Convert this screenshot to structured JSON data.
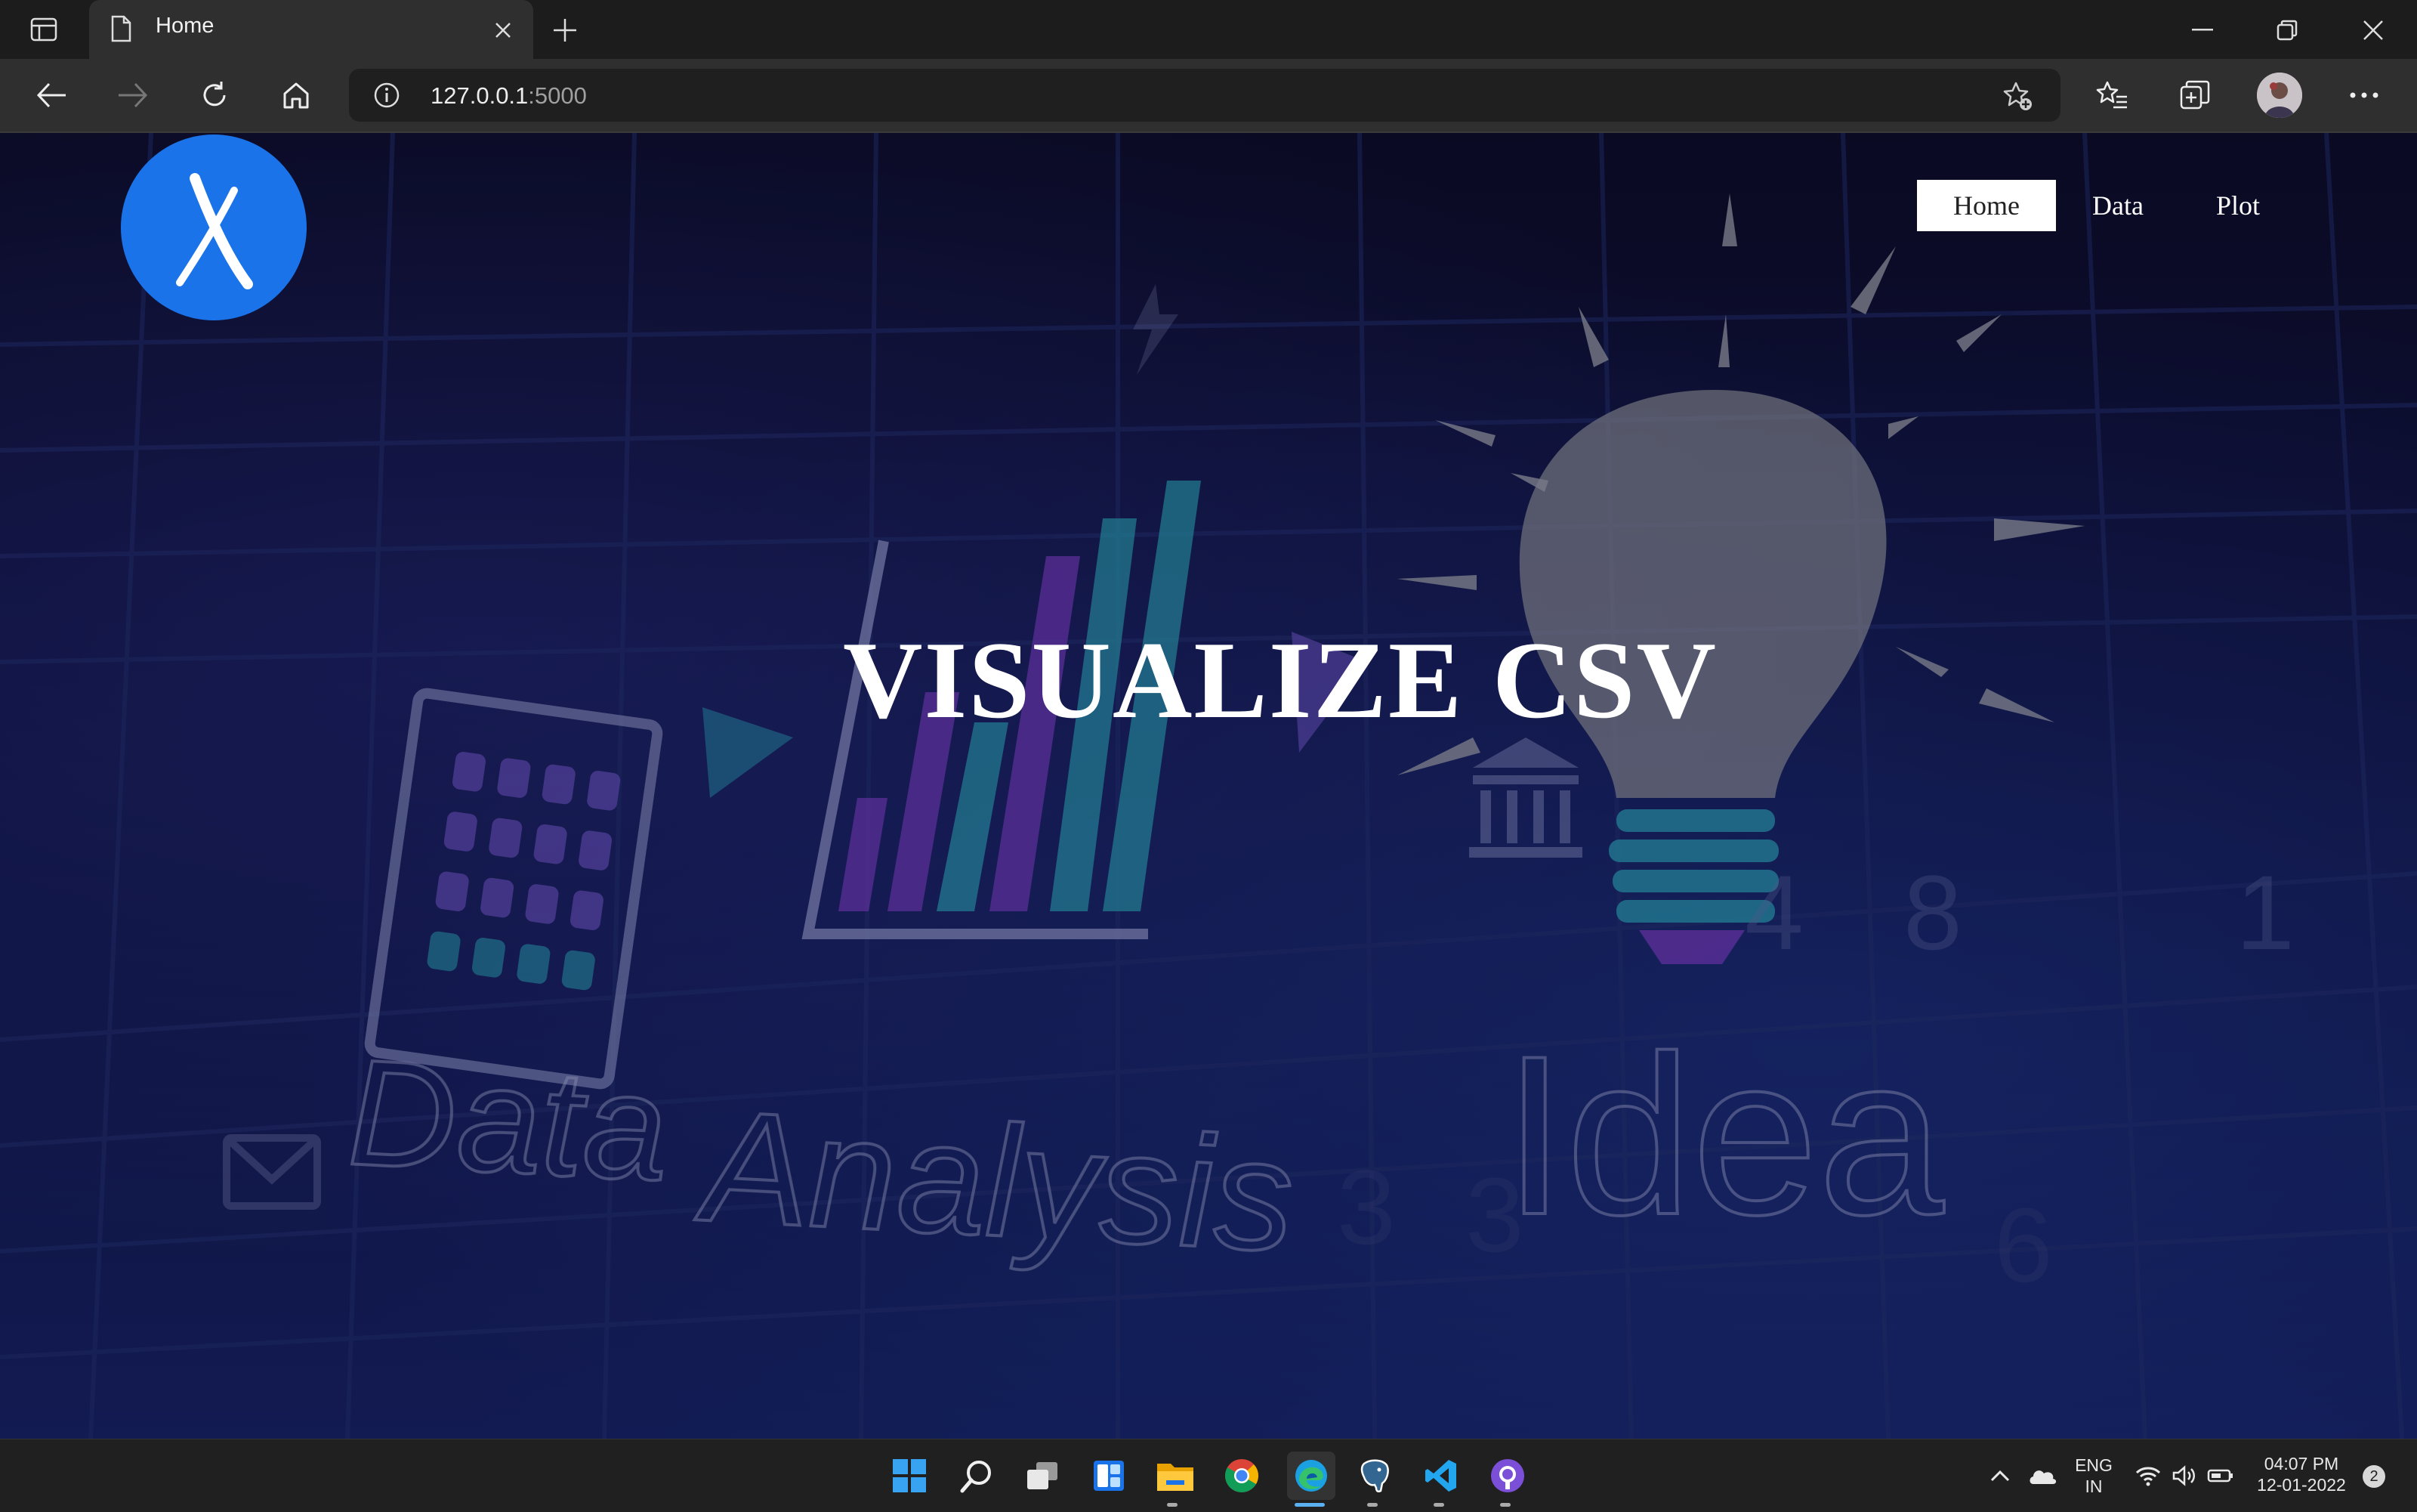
{
  "browser": {
    "tab_title": "Home",
    "url_host": "127.0.0.1",
    "url_port": ":5000"
  },
  "page": {
    "nav": [
      "Home",
      "Data",
      "Plot"
    ],
    "active_nav": "Home",
    "hero_title": "VISUALIZE CSV",
    "background_words": [
      "Data",
      "Analysis",
      "Idea"
    ]
  },
  "taskbar": {
    "language_line1": "ENG",
    "language_line2": "IN",
    "time": "04:07 PM",
    "date": "12-01-2022",
    "notification_count": "2"
  },
  "colors": {
    "logo_blue": "#1a73e8",
    "page_bg": "#0e0f38"
  }
}
